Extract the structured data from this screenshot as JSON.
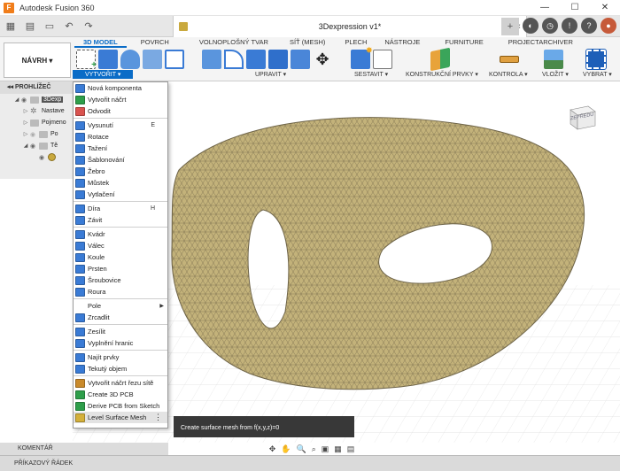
{
  "app": {
    "title": "Autodesk Fusion 360",
    "icon_letter": "F",
    "window_buttons": [
      "—",
      "☐",
      "✕"
    ]
  },
  "doc_tab": {
    "title": "3Dexpression v1*",
    "close": "×"
  },
  "ribbon": {
    "workspace": "NÁVRH ▾",
    "tabs": [
      "3D MODEL",
      "POVRCH",
      "VOLNOPLOŠNÝ TVAR",
      "SÍŤ (MESH)",
      "PLECH",
      "NÁSTROJE",
      "FURNITURE",
      "PROJECTARCHIVER"
    ],
    "groups": [
      "VYTVOŘIT ▾",
      "UPRAVIT ▾",
      "SESTAVIT ▾",
      "KONSTRUKČNÍ PRVKY ▾",
      "KONTROLA ▾",
      "VLOŽIT ▾",
      "VYBRAT ▾"
    ]
  },
  "browser": {
    "header": "PROHLÍŽEČ",
    "rows": [
      "3Dexp",
      "Nastave",
      "Pojmeno",
      "Po",
      "Tě",
      ""
    ]
  },
  "menu": {
    "items": [
      {
        "label": "Nová komponenta",
        "color": "#3a7bd5"
      },
      {
        "label": "Vytvořit náčrt",
        "color": "#2e9e4a"
      },
      {
        "label": "Odvodit",
        "color": "#d9534f"
      },
      {
        "label": "Vysunutí",
        "shortcut": "E",
        "color": "#3a7bd5"
      },
      {
        "label": "Rotace",
        "color": "#3a7bd5"
      },
      {
        "label": "Tažení",
        "color": "#3a7bd5"
      },
      {
        "label": "Šablonování",
        "color": "#3a7bd5"
      },
      {
        "label": "Žebro",
        "color": "#3a7bd5"
      },
      {
        "label": "Můstek",
        "color": "#3a7bd5"
      },
      {
        "label": "Vytlačení",
        "color": "#3a7bd5"
      },
      {
        "label": "Díra",
        "shortcut": "H",
        "color": "#3a7bd5"
      },
      {
        "label": "Závit",
        "color": "#3a7bd5"
      },
      {
        "label": "Kvádr",
        "color": "#3a7bd5"
      },
      {
        "label": "Válec",
        "color": "#3a7bd5"
      },
      {
        "label": "Koule",
        "color": "#3a7bd5"
      },
      {
        "label": "Prsten",
        "color": "#3a7bd5"
      },
      {
        "label": "Šroubovice",
        "color": "#3a7bd5"
      },
      {
        "label": "Roura",
        "color": "#3a7bd5"
      },
      {
        "label": "Pole",
        "arrow": "▶",
        "color": "#ffffff"
      },
      {
        "label": "Zrcadlit",
        "color": "#3a7bd5"
      },
      {
        "label": "Zesílit",
        "color": "#3a7bd5"
      },
      {
        "label": "Vyplnění hranic",
        "color": "#3a7bd5"
      },
      {
        "label": "Najít prvky",
        "color": "#3a7bd5"
      },
      {
        "label": "Tekutý objem",
        "color": "#3a7bd5"
      },
      {
        "label": "Vytvořit náčrt řezu sítě",
        "color": "#c98a2b"
      },
      {
        "label": "Create 3D PCB",
        "color": "#2e9e4a"
      },
      {
        "label": "Derive PCB from Sketch",
        "color": "#2e9e4a"
      },
      {
        "label": "Level Surface Mesh",
        "color": "#d4b03a",
        "more": "⋮"
      }
    ]
  },
  "tooltip": "Create surface mesh from f(x,y,z)=0",
  "viewcube": {
    "face": "ZEPŘEDU"
  },
  "bottom": {
    "comments": "KOMENTÁŘ",
    "command_line": "PŘÍKAZOVÝ ŘÁDEK",
    "nav_icons": [
      "✥",
      "✋",
      "🔍",
      "⌕",
      "▣",
      "▦",
      "▤"
    ]
  },
  "colors": {
    "accent": "#0a6cc7",
    "mesh_fill": "#c3b27a",
    "mesh_line": "#6e6448"
  }
}
